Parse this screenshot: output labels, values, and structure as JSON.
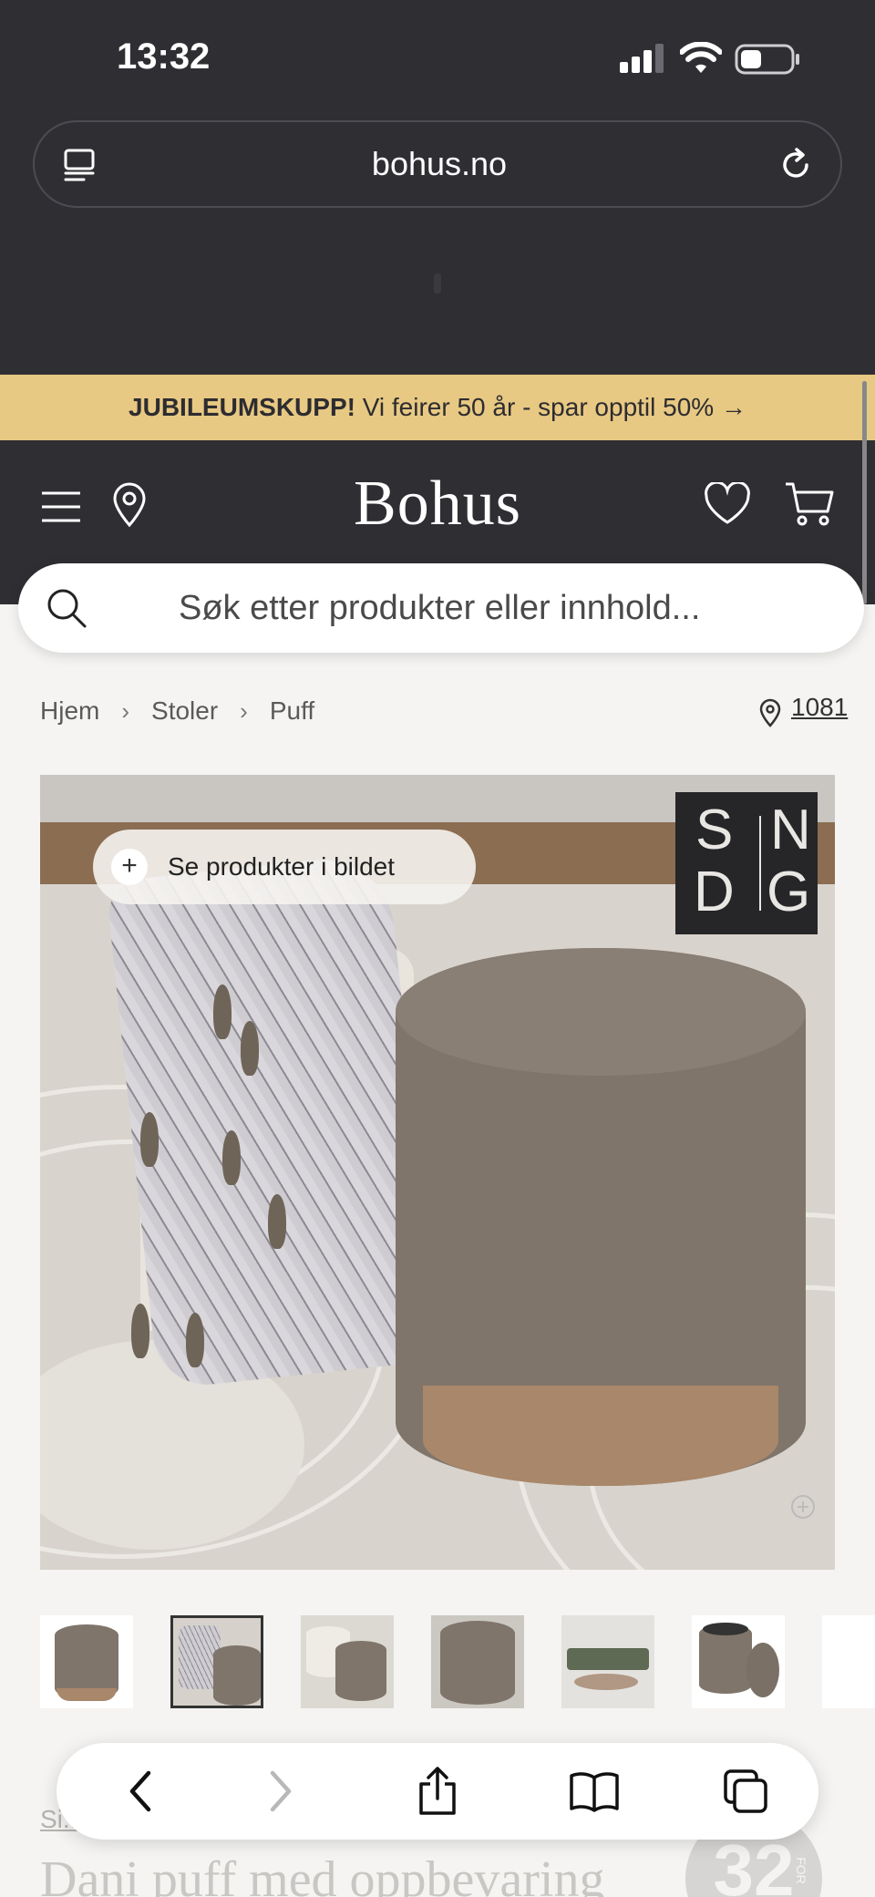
{
  "status_bar": {
    "time": "13:32"
  },
  "browser": {
    "url": "bohus.no"
  },
  "promo": {
    "bold": "JUBILEUMSKUPP!",
    "text": " Vi feirer 50 år - spar opptil 50% →"
  },
  "header": {
    "logo": "Bohus"
  },
  "search": {
    "placeholder": "Søk etter produkter eller innhold..."
  },
  "breadcrumb": {
    "items": [
      "Hjem",
      "Stoler",
      "Puff"
    ],
    "store_code": "1081"
  },
  "product_image": {
    "see_products_label": "Se produkter i bildet",
    "brand_badge": {
      "top_left": "S",
      "top_right": "N",
      "bottom_left": "D",
      "bottom_right": "G"
    }
  },
  "product": {
    "brand_link": "Si...",
    "title": "Dani puff med oppbevaring",
    "deal_number": "32",
    "deal_suffix": "FOR"
  },
  "colors": {
    "banner": "#e8c983",
    "header_bg": "#2f2e33",
    "page_bg": "#f5f4f2"
  }
}
